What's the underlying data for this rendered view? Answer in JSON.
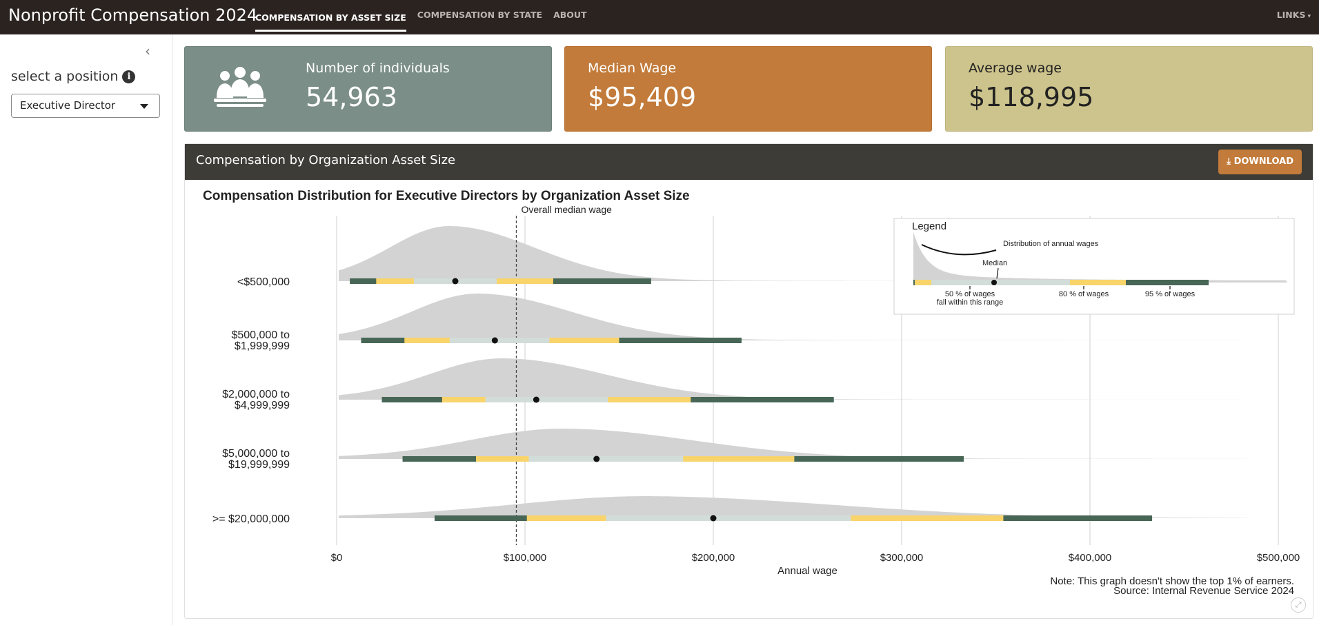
{
  "app": {
    "title": "Nonprofit Compensation 2024",
    "nav": [
      {
        "label": "COMPENSATION BY ASSET SIZE",
        "active": true
      },
      {
        "label": "COMPENSATION BY STATE",
        "active": false
      },
      {
        "label": "ABOUT",
        "active": false
      }
    ],
    "links_label": "LINKS"
  },
  "sidebar": {
    "position_label": "select a position",
    "selected_position": "Executive Director"
  },
  "cards": {
    "individuals": {
      "label": "Number of individuals",
      "value": "54,963"
    },
    "median": {
      "label": "Median Wage",
      "value": "$95,409"
    },
    "average": {
      "label": "Average wage",
      "value": "$118,995"
    }
  },
  "colors": {
    "topbar": "#2b2320",
    "card_individuals": "#7b8e87",
    "card_median": "#c27b3a",
    "card_average": "#cdc48d",
    "panel_header": "#3e3c37",
    "density": "#d3d3d3",
    "range_95": "#476656",
    "range_80": "#f9d46b",
    "range_50": "#d2dcd8"
  },
  "panel": {
    "title": "Compensation by Organization Asset Size",
    "download_label": "DOWNLOAD"
  },
  "chart_data": {
    "type": "density-ridgeline",
    "title": "Compensation Distribution for Executive Directors by Organization Asset Size",
    "xlabel": "Annual wage",
    "ylabel": "",
    "xlim": [
      0,
      500000
    ],
    "x_ticks": [
      0,
      100000,
      200000,
      300000,
      400000,
      500000
    ],
    "x_tick_labels": [
      "$0",
      "$100,000",
      "$200,000",
      "$300,000",
      "$400,000",
      "$500,000"
    ],
    "grid": true,
    "reference_line": {
      "label": "Overall median wage",
      "value": 95409
    },
    "categories": [
      "<$500,000",
      "$500,000 to $1,999,999",
      "$2,000,000 to $4,999,999",
      "$5,000,000 to $19,999,999",
      ">= $20,000,000"
    ],
    "category_lines": [
      [
        "<$500,000"
      ],
      [
        "$500,000 to",
        "$1,999,999"
      ],
      [
        "$2,000,000 to",
        "$4,999,999"
      ],
      [
        "$5,000,000 to",
        "$19,999,999"
      ],
      [
        ">= $20,000,000"
      ]
    ],
    "series": [
      {
        "category": "<$500,000",
        "median": 63000,
        "p025": 7000,
        "p10": 21000,
        "p25": 41000,
        "p75": 85000,
        "p90": 115000,
        "p975": 167000,
        "density_peak": 60000,
        "density_max_x": 480000
      },
      {
        "category": "$500,000 to $1,999,999",
        "median": 84000,
        "p025": 13000,
        "p10": 36000,
        "p25": 60000,
        "p75": 113000,
        "p90": 150000,
        "p975": 215000,
        "density_peak": 75000,
        "density_max_x": 480000
      },
      {
        "category": "$2,000,000 to $4,999,999",
        "median": 106000,
        "p025": 24000,
        "p10": 56000,
        "p25": 79000,
        "p75": 144000,
        "p90": 188000,
        "p975": 264000,
        "density_peak": 88000,
        "density_max_x": 480000
      },
      {
        "category": "$5,000,000 to $19,999,999",
        "median": 138000,
        "p025": 35000,
        "p10": 74000,
        "p25": 102000,
        "p75": 184000,
        "p90": 243000,
        "p975": 333000,
        "density_peak": 120000,
        "density_max_x": 483000
      },
      {
        "category": ">= $20,000,000",
        "median": 200000,
        "p025": 52000,
        "p10": 101000,
        "p25": 143000,
        "p75": 273000,
        "p90": 354000,
        "p975": 433000,
        "density_peak": 165000,
        "density_max_x": 485000
      }
    ],
    "legend": {
      "title": "Legend",
      "distribution_label": "Distribution of annual wages",
      "median_label": "Median",
      "range50_label_line1": "50 % of wages",
      "range50_label_line2": "fall within this range",
      "range80_label": "80 % of wages",
      "range95_label": "95 % of wages"
    },
    "notes": [
      "Note: This graph doesn't show the top 1% of earners.",
      "Source: Internal Revenue Service 2024"
    ]
  }
}
